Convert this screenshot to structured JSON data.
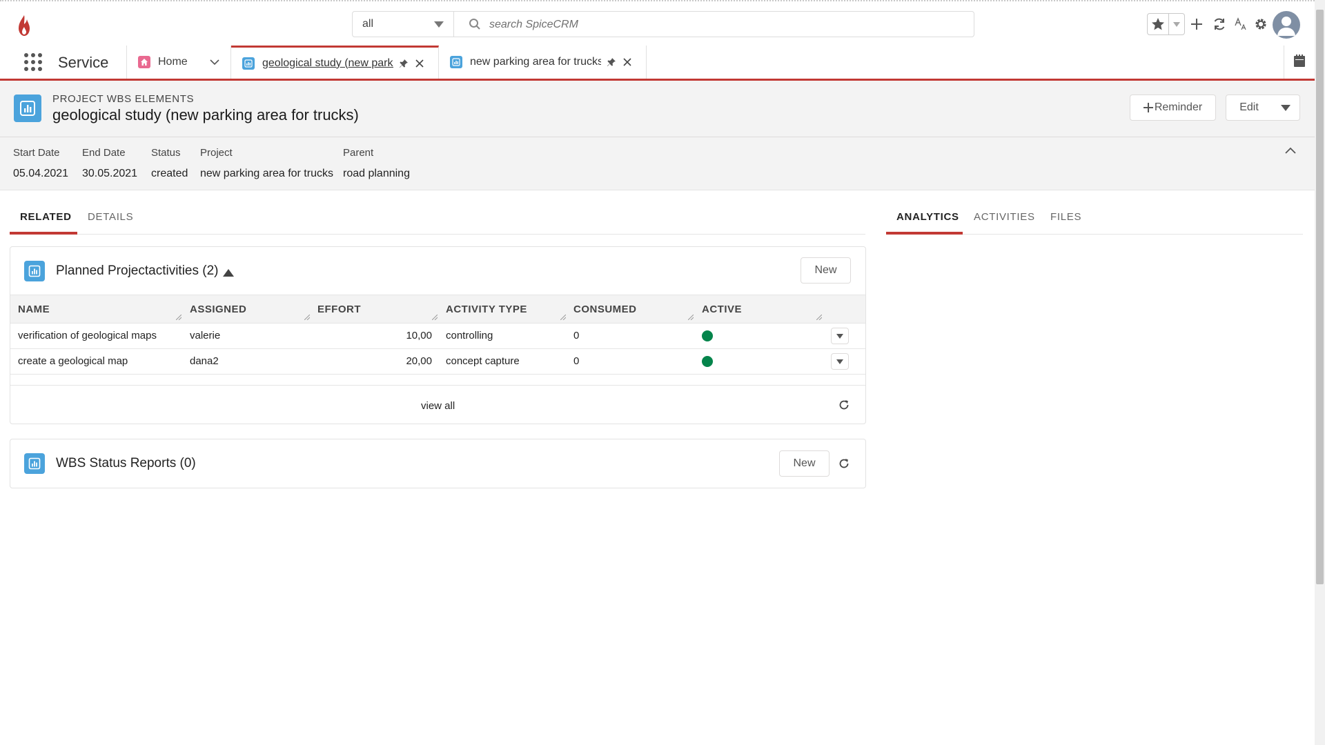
{
  "header": {
    "search_scope": "all",
    "search_placeholder": "search SpiceCRM"
  },
  "nav": {
    "app_name": "Service",
    "tabs": [
      {
        "label": "Home"
      },
      {
        "label": "geological study (new parkir"
      },
      {
        "label": "new parking area for trucks"
      }
    ]
  },
  "record": {
    "type_label": "PROJECT WBS ELEMENTS",
    "title": "geological study (new parking area for trucks)",
    "reminder_label": "Reminder",
    "edit_label": "Edit"
  },
  "fields": [
    {
      "label": "Start Date",
      "value": "05.04.2021"
    },
    {
      "label": "End Date",
      "value": "30.05.2021"
    },
    {
      "label": "Status",
      "value": "created"
    },
    {
      "label": "Project",
      "value": "new parking area for trucks"
    },
    {
      "label": "Parent",
      "value": "road planning"
    }
  ],
  "left_tabs": [
    "RELATED",
    "DETAILS"
  ],
  "right_tabs": [
    "ANALYTICS",
    "ACTIVITIES",
    "FILES"
  ],
  "activities": {
    "title": "Planned Projectactivities (2)",
    "new_label": "New",
    "columns": [
      "NAME",
      "ASSIGNED",
      "EFFORT",
      "ACTIVITY TYPE",
      "CONSUMED",
      "ACTIVE"
    ],
    "rows": [
      {
        "name": "verification of geological maps",
        "assigned": "valerie",
        "effort": "10,00",
        "activity_type": "controlling",
        "consumed": "0",
        "active": true
      },
      {
        "name": "create a geological map",
        "assigned": "dana2",
        "effort": "20,00",
        "activity_type": "concept capture",
        "consumed": "0",
        "active": true
      }
    ],
    "view_all_label": "view all"
  },
  "reports": {
    "title": "WBS Status Reports (0)",
    "new_label": "New"
  },
  "colors": {
    "accent": "#c23934",
    "module_blue": "#4ba3dc",
    "active_green": "#04844b",
    "home_pink": "#e96990"
  }
}
